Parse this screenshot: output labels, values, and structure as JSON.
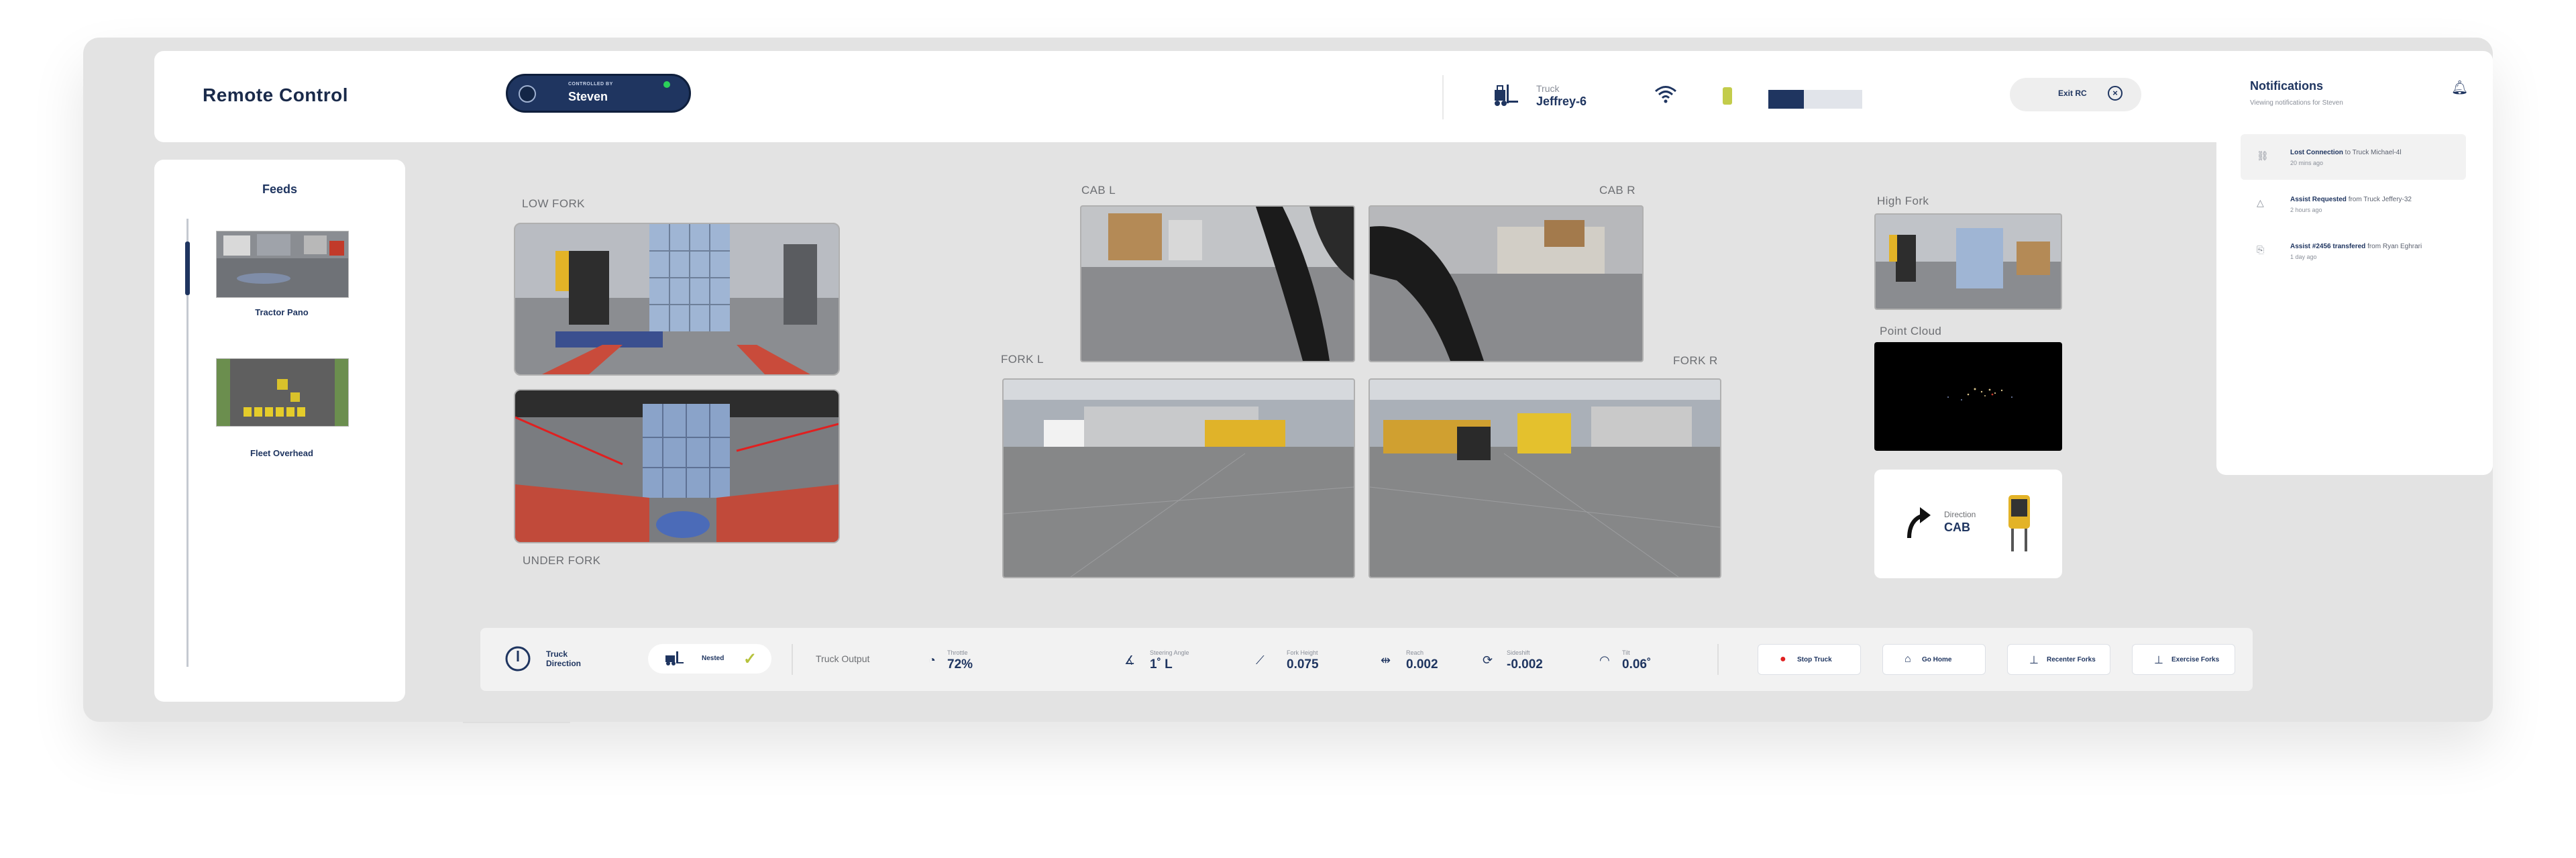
{
  "header": {
    "title": "Remote Control",
    "controlled_by_label": "CONTROLLED BY",
    "controlled_by_name": "Steven",
    "truck_label": "Truck",
    "truck_name": "Jeffrey-6",
    "progress_fraction": 0.38,
    "exit_label": "Exit RC",
    "exit_icon": "close-icon",
    "icons": [
      "forklift-icon",
      "wifi-icon",
      "battery-icon"
    ]
  },
  "feeds": {
    "title": "Feeds",
    "items": [
      {
        "label": "Tractor Pano"
      },
      {
        "label": "Fleet Overhead"
      }
    ]
  },
  "cameras": {
    "low_fork": "LOW FORK",
    "under_fork": "UNDER FORK",
    "cab_l": "CAB L",
    "cab_r": "CAB R",
    "fork_l": "FORK L",
    "fork_r": "FORK R",
    "high_fork": "High Fork",
    "point_cloud": "Point Cloud"
  },
  "direction": {
    "label": "Direction",
    "value": "CAB"
  },
  "bottom_bar": {
    "truck_direction": "Truck\nDirection",
    "nested_label": "Nested",
    "truck_output": "Truck Output",
    "metrics": [
      {
        "label": "Throttle",
        "value": "72%",
        "icon": "gauge-icon"
      },
      {
        "label": "Steering Angle",
        "value": "1˚ L",
        "icon": "angle-icon"
      },
      {
        "label": "Fork Height",
        "value": "0.075",
        "icon": "ruler-icon"
      },
      {
        "label": "Reach",
        "value": "0.002",
        "icon": "reach-icon"
      },
      {
        "label": "Sideshift",
        "value": "-0.002",
        "icon": "sideshift-icon"
      },
      {
        "label": "Tilt",
        "value": "0.06˚",
        "icon": "tilt-icon"
      }
    ],
    "actions": [
      {
        "label": "Stop Truck",
        "icon": "stop-icon"
      },
      {
        "label": "Go Home",
        "icon": "home-icon"
      },
      {
        "label": "Recenter Forks",
        "icon": "forks-icon"
      },
      {
        "label": "Exercise Forks",
        "icon": "forks-icon"
      }
    ]
  },
  "notifications": {
    "title": "Notifications",
    "subtitle": "Viewing notifications for Steven",
    "items": [
      {
        "bold": "Lost Connection",
        "rest": " to Truck Michael-4l",
        "time": "20 mins ago",
        "icon": "disconnect-icon"
      },
      {
        "bold": "Assist Requested",
        "rest": " from Truck Jeffery-32",
        "time": "2 hours ago",
        "icon": "warning-icon"
      },
      {
        "bold": "Assist #2456 transfered",
        "rest": " from Ryan Eghrari",
        "time": "1 day ago",
        "icon": "transfer-icon"
      }
    ]
  },
  "colors": {
    "navy": "#1f3560",
    "accent_green": "#2bd15a",
    "battery": "#c3cc4b",
    "stop_red": "#e02020",
    "check": "#b6c23c"
  }
}
